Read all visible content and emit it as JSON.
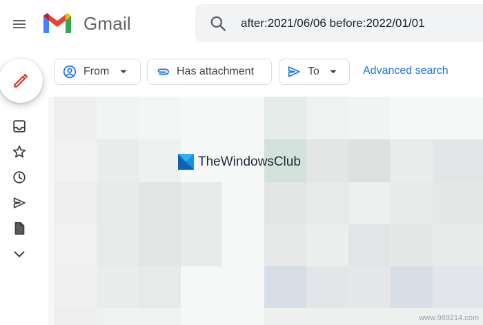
{
  "header": {
    "app_name": "Gmail",
    "search_query": "after:2021/06/06 before:2022/01/01"
  },
  "icons": {
    "menu": "hamburger-menu-icon",
    "logo": "gmail-m-logo",
    "search": "search-icon",
    "compose": "pencil-icon",
    "inbox": "inbox-icon",
    "starred": "star-icon",
    "snoozed": "clock-icon",
    "sent": "send-icon",
    "drafts": "file-icon",
    "more": "chevron-down-icon"
  },
  "filters": {
    "from_label": "From",
    "attachment_label": "Has attachment",
    "to_label": "To",
    "advanced_search_label": "Advanced search"
  },
  "watermark": {
    "text": "TheWindowsClub"
  },
  "footer": {
    "site_url": "www.989214.com"
  },
  "colors": {
    "accent_blue": "#1a73e8",
    "compose_red": "#d93025",
    "search_bg": "#f1f3f4",
    "text_gray": "#5f6368"
  }
}
